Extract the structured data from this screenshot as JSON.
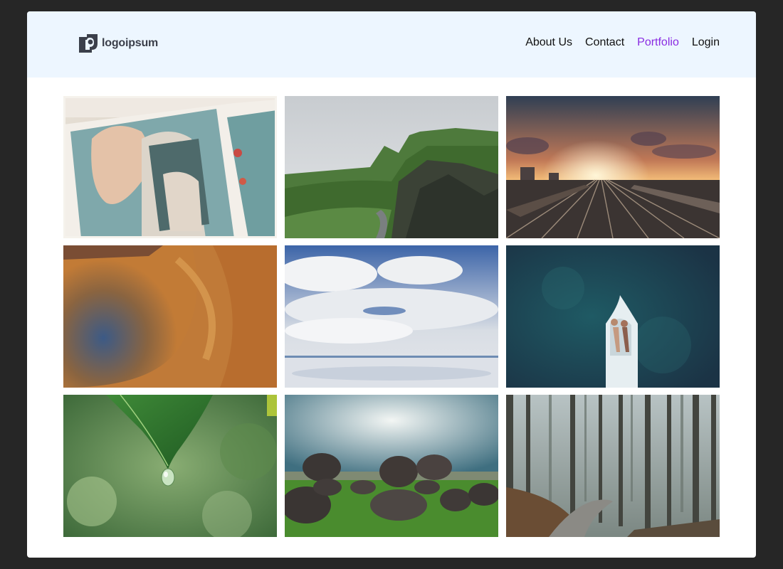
{
  "header": {
    "logo_text": "logoipsum",
    "nav": {
      "about": "About Us",
      "contact": "Contact",
      "portfolio": "Portfolio",
      "login": "Login"
    },
    "active_nav": "portfolio"
  },
  "colors": {
    "page_background": "#262626",
    "header_background": "#edf6ff",
    "active_link": "#8a2be2",
    "link": "#111111",
    "logo": "#3b3f4a"
  },
  "gallery": {
    "photos": [
      "wedding-couple-in-vintage-car",
      "green-mountain-cliffs-with-road",
      "sunset-over-railway-yard",
      "aerial-crater-orange-terrain",
      "clouds-reflected-on-salt-flat",
      "couple-on-boat-aerial-teal-water",
      "water-drop-on-leaf",
      "boulders-on-grass-under-sun-rays",
      "misty-pine-forest-path"
    ]
  }
}
